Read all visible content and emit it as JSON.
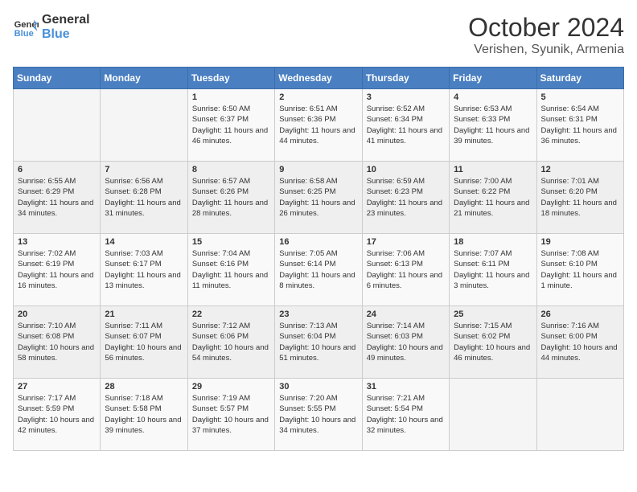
{
  "header": {
    "logo_line1": "General",
    "logo_line2": "Blue",
    "month": "October 2024",
    "location": "Verishen, Syunik, Armenia"
  },
  "days_of_week": [
    "Sunday",
    "Monday",
    "Tuesday",
    "Wednesday",
    "Thursday",
    "Friday",
    "Saturday"
  ],
  "weeks": [
    [
      {
        "day": "",
        "info": ""
      },
      {
        "day": "",
        "info": ""
      },
      {
        "day": "1",
        "info": "Sunrise: 6:50 AM\nSunset: 6:37 PM\nDaylight: 11 hours and 46 minutes."
      },
      {
        "day": "2",
        "info": "Sunrise: 6:51 AM\nSunset: 6:36 PM\nDaylight: 11 hours and 44 minutes."
      },
      {
        "day": "3",
        "info": "Sunrise: 6:52 AM\nSunset: 6:34 PM\nDaylight: 11 hours and 41 minutes."
      },
      {
        "day": "4",
        "info": "Sunrise: 6:53 AM\nSunset: 6:33 PM\nDaylight: 11 hours and 39 minutes."
      },
      {
        "day": "5",
        "info": "Sunrise: 6:54 AM\nSunset: 6:31 PM\nDaylight: 11 hours and 36 minutes."
      }
    ],
    [
      {
        "day": "6",
        "info": "Sunrise: 6:55 AM\nSunset: 6:29 PM\nDaylight: 11 hours and 34 minutes."
      },
      {
        "day": "7",
        "info": "Sunrise: 6:56 AM\nSunset: 6:28 PM\nDaylight: 11 hours and 31 minutes."
      },
      {
        "day": "8",
        "info": "Sunrise: 6:57 AM\nSunset: 6:26 PM\nDaylight: 11 hours and 28 minutes."
      },
      {
        "day": "9",
        "info": "Sunrise: 6:58 AM\nSunset: 6:25 PM\nDaylight: 11 hours and 26 minutes."
      },
      {
        "day": "10",
        "info": "Sunrise: 6:59 AM\nSunset: 6:23 PM\nDaylight: 11 hours and 23 minutes."
      },
      {
        "day": "11",
        "info": "Sunrise: 7:00 AM\nSunset: 6:22 PM\nDaylight: 11 hours and 21 minutes."
      },
      {
        "day": "12",
        "info": "Sunrise: 7:01 AM\nSunset: 6:20 PM\nDaylight: 11 hours and 18 minutes."
      }
    ],
    [
      {
        "day": "13",
        "info": "Sunrise: 7:02 AM\nSunset: 6:19 PM\nDaylight: 11 hours and 16 minutes."
      },
      {
        "day": "14",
        "info": "Sunrise: 7:03 AM\nSunset: 6:17 PM\nDaylight: 11 hours and 13 minutes."
      },
      {
        "day": "15",
        "info": "Sunrise: 7:04 AM\nSunset: 6:16 PM\nDaylight: 11 hours and 11 minutes."
      },
      {
        "day": "16",
        "info": "Sunrise: 7:05 AM\nSunset: 6:14 PM\nDaylight: 11 hours and 8 minutes."
      },
      {
        "day": "17",
        "info": "Sunrise: 7:06 AM\nSunset: 6:13 PM\nDaylight: 11 hours and 6 minutes."
      },
      {
        "day": "18",
        "info": "Sunrise: 7:07 AM\nSunset: 6:11 PM\nDaylight: 11 hours and 3 minutes."
      },
      {
        "day": "19",
        "info": "Sunrise: 7:08 AM\nSunset: 6:10 PM\nDaylight: 11 hours and 1 minute."
      }
    ],
    [
      {
        "day": "20",
        "info": "Sunrise: 7:10 AM\nSunset: 6:08 PM\nDaylight: 10 hours and 58 minutes."
      },
      {
        "day": "21",
        "info": "Sunrise: 7:11 AM\nSunset: 6:07 PM\nDaylight: 10 hours and 56 minutes."
      },
      {
        "day": "22",
        "info": "Sunrise: 7:12 AM\nSunset: 6:06 PM\nDaylight: 10 hours and 54 minutes."
      },
      {
        "day": "23",
        "info": "Sunrise: 7:13 AM\nSunset: 6:04 PM\nDaylight: 10 hours and 51 minutes."
      },
      {
        "day": "24",
        "info": "Sunrise: 7:14 AM\nSunset: 6:03 PM\nDaylight: 10 hours and 49 minutes."
      },
      {
        "day": "25",
        "info": "Sunrise: 7:15 AM\nSunset: 6:02 PM\nDaylight: 10 hours and 46 minutes."
      },
      {
        "day": "26",
        "info": "Sunrise: 7:16 AM\nSunset: 6:00 PM\nDaylight: 10 hours and 44 minutes."
      }
    ],
    [
      {
        "day": "27",
        "info": "Sunrise: 7:17 AM\nSunset: 5:59 PM\nDaylight: 10 hours and 42 minutes."
      },
      {
        "day": "28",
        "info": "Sunrise: 7:18 AM\nSunset: 5:58 PM\nDaylight: 10 hours and 39 minutes."
      },
      {
        "day": "29",
        "info": "Sunrise: 7:19 AM\nSunset: 5:57 PM\nDaylight: 10 hours and 37 minutes."
      },
      {
        "day": "30",
        "info": "Sunrise: 7:20 AM\nSunset: 5:55 PM\nDaylight: 10 hours and 34 minutes."
      },
      {
        "day": "31",
        "info": "Sunrise: 7:21 AM\nSunset: 5:54 PM\nDaylight: 10 hours and 32 minutes."
      },
      {
        "day": "",
        "info": ""
      },
      {
        "day": "",
        "info": ""
      }
    ]
  ]
}
